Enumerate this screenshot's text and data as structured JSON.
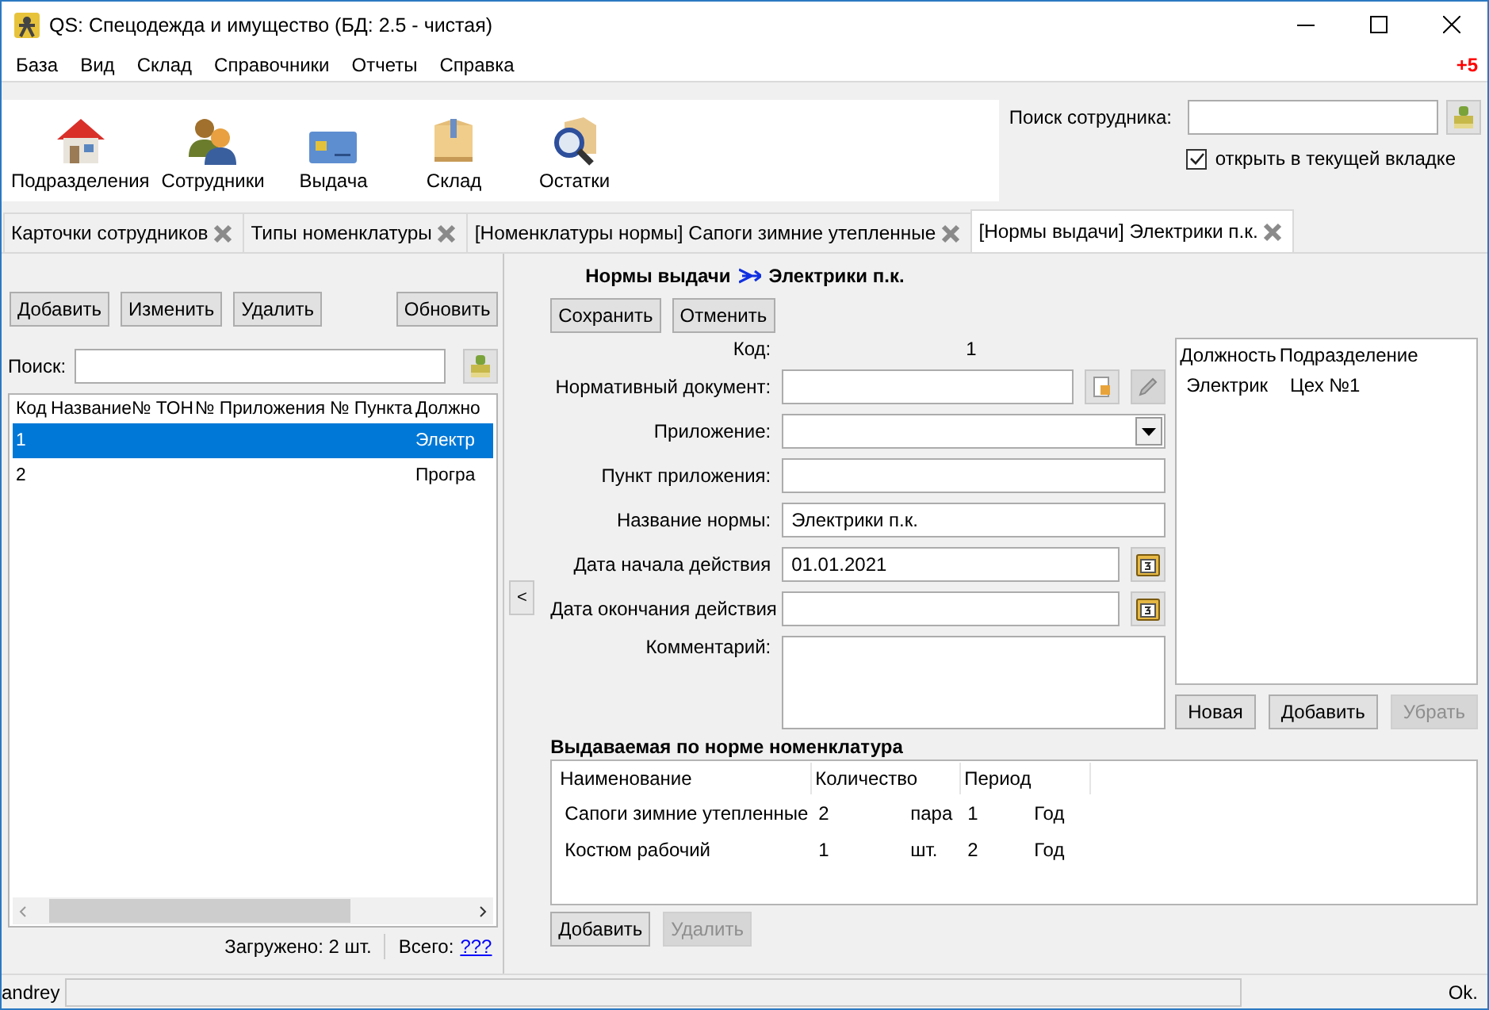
{
  "window": {
    "title": "QS: Спецодежда и имущество (БД: 2.5 - чистая)"
  },
  "menu": {
    "items": [
      "База",
      "Вид",
      "Склад",
      "Справочники",
      "Отчеты",
      "Справка"
    ],
    "badge": "+5"
  },
  "toolbar": [
    {
      "label": "Подразделения",
      "kind": "house"
    },
    {
      "label": "Сотрудники",
      "kind": "people"
    },
    {
      "label": "Выдача",
      "kind": "card"
    },
    {
      "label": "Склад",
      "kind": "box"
    },
    {
      "label": "Остатки",
      "kind": "search-box"
    }
  ],
  "employee_search": {
    "label": "Поиск сотрудника:",
    "open_in_current_tab": {
      "label": "открыть в текущей вкладке",
      "checked": true
    }
  },
  "tabs": [
    {
      "label": "Карточки сотрудников",
      "selected": false
    },
    {
      "label": "Типы номенклатуры",
      "selected": false
    },
    {
      "label": "[Номенклатуры нормы] Сапоги зимние утепленные",
      "selected": false
    },
    {
      "label": "[Нормы выдачи] Электрики п.к.",
      "selected": true
    }
  ],
  "left_panel": {
    "buttons": [
      "Добавить",
      "Изменить",
      "Удалить"
    ],
    "refresh_button": "Обновить",
    "search_label": "Поиск:",
    "table": {
      "columns": [
        "Код",
        "Название",
        "№ ТОН",
        "№ Приложения",
        "№ Пункта",
        "Должно"
      ],
      "rows": [
        {
          "cells": [
            "1",
            "",
            "",
            "",
            "",
            "Электр"
          ],
          "selected": true
        },
        {
          "cells": [
            "2",
            "",
            "",
            "",
            "",
            "Програ"
          ],
          "selected": false
        }
      ]
    },
    "loaded": "Загружено: 2 шт.",
    "total_label": "Всего:",
    "total_link": "???"
  },
  "splitter_button": "<",
  "editor": {
    "breadcrumb": [
      "Нормы выдачи",
      "Электрики п.к."
    ],
    "buttons": [
      "Сохранить",
      "Отменить"
    ],
    "fields": [
      {
        "kind": "static",
        "label": "Код:",
        "value": "1"
      },
      {
        "kind": "doc",
        "label": "Нормативный документ:"
      },
      {
        "kind": "select",
        "label": "Приложение:"
      },
      {
        "kind": "input",
        "label": "Пункт приложения:"
      },
      {
        "kind": "input",
        "label": "Название нормы:",
        "value": "Электрики п.к."
      },
      {
        "kind": "date",
        "label": "Дата начала действия",
        "value": "01.01.2021"
      },
      {
        "kind": "date",
        "label": "Дата окончания действия"
      },
      {
        "kind": "textarea",
        "label": "Комментарий:"
      }
    ],
    "positions": {
      "columns": [
        "Должность",
        "Подразделение"
      ],
      "rows": [
        [
          "Электрик",
          "Цех №1"
        ]
      ],
      "buttons": [
        {
          "label": "Новая",
          "disabled": false
        },
        {
          "label": "Добавить",
          "disabled": false
        },
        {
          "label": "Убрать",
          "disabled": true
        }
      ]
    },
    "items": {
      "title": "Выдаваемая по норме номенклатура",
      "columns": [
        "Наименование",
        "Количество",
        "Период"
      ],
      "rows": [
        {
          "name": "Сапоги зимние утепленные",
          "quantity": [
            "2",
            "пара"
          ],
          "period": [
            "1",
            "Год"
          ]
        },
        {
          "name": "Костюм рабочий",
          "quantity": [
            "1",
            "шт."
          ],
          "period": [
            "2",
            "Год"
          ]
        }
      ],
      "buttons": [
        {
          "label": "Добавить",
          "disabled": false
        },
        {
          "label": "Удалить",
          "disabled": true
        }
      ]
    }
  },
  "status_bar": {
    "user": "andrey",
    "message": "Ok."
  }
}
